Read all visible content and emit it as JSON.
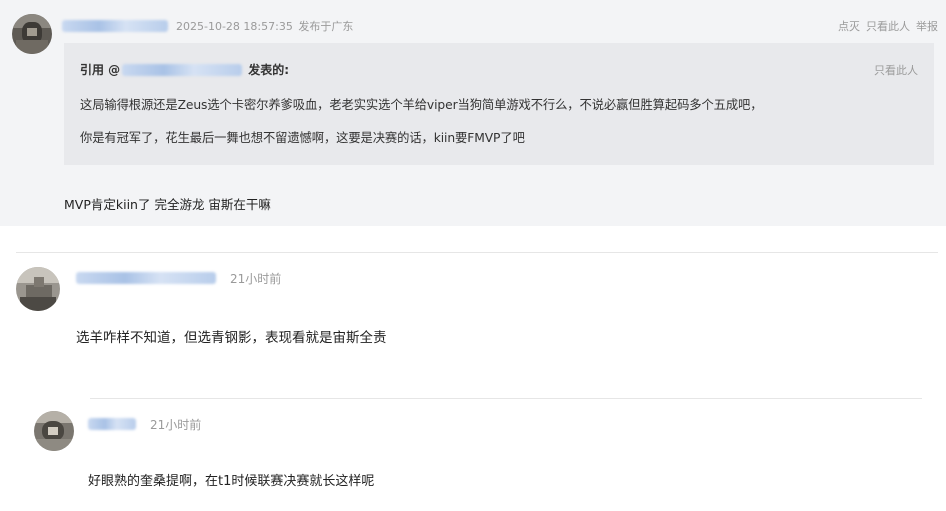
{
  "post1": {
    "timestamp": "2025-10-28 18:57:35",
    "location": "发布于广东",
    "actions": [
      "点灭",
      "只看此人",
      "举报"
    ],
    "quote": {
      "prefix": "引用 @",
      "suffix": "发表的:",
      "only_this": "只看此人",
      "line1": "这局输得根源还是Zeus选个卡密尔养爹吸血，老老实实选个羊给viper当狗简单游戏不行么，不说必赢但胜算起码多个五成吧，",
      "line2": "你是有冠军了，花生最后一舞也想不留遗憾啊，这要是决赛的话，kiin要FMVP了吧"
    },
    "text": "MVP肯定kiin了 完全游龙 宙斯在干嘛"
  },
  "reply1": {
    "time": "21小时前",
    "text": "选羊咋样不知道，但选青钢影，表现看就是宙斯全责"
  },
  "reply2": {
    "time": "21小时前",
    "text": "好眼熟的奎桑提啊，在t1时候联赛决赛就长这样呢"
  }
}
